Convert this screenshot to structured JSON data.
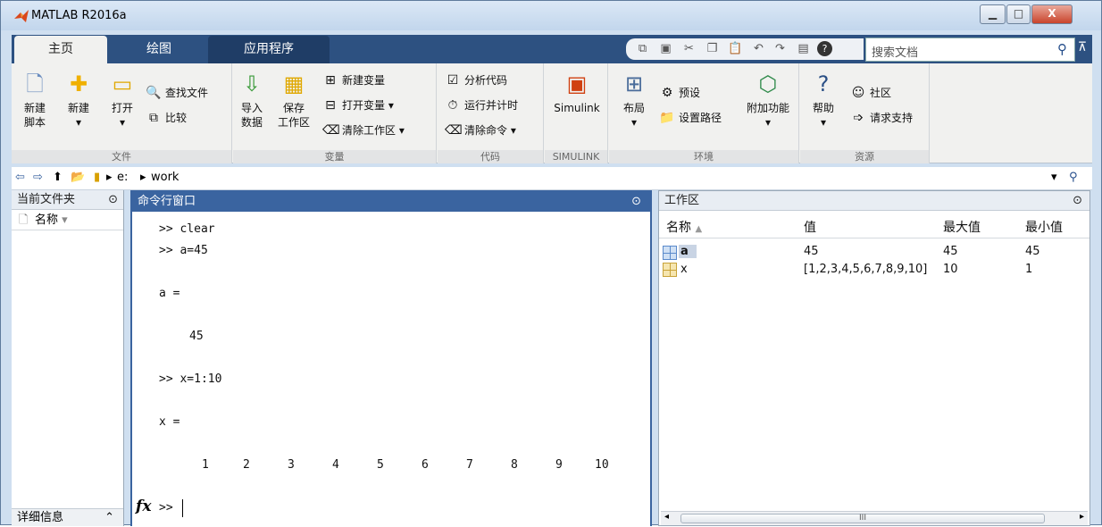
{
  "window": {
    "title": "MATLAB R2016a"
  },
  "tabs": [
    {
      "label": "主页"
    },
    {
      "label": "绘图"
    },
    {
      "label": "应用程序"
    }
  ],
  "search": {
    "placeholder": "搜索文档"
  },
  "ribbon": {
    "file": {
      "title": "文件",
      "new_script": "新建\n脚本",
      "new": "新建",
      "open": "打开",
      "find_files": "查找文件",
      "compare": "比较"
    },
    "variable": {
      "title": "变量",
      "import": "导入\n数据",
      "save": "保存\n工作区",
      "new_var": "新建变量",
      "open_var": "打开变量",
      "clear_ws": "清除工作区"
    },
    "code": {
      "title": "代码",
      "analyze": "分析代码",
      "run_time": "运行并计时",
      "clear_cmd": "清除命令"
    },
    "simulink": {
      "title": "SIMULINK",
      "label": "Simulink"
    },
    "env": {
      "title": "环境",
      "layout": "布局",
      "prefs": "预设",
      "set_path": "设置路径",
      "addons": "附加功能"
    },
    "resources": {
      "title": "资源",
      "help": "帮助",
      "community": "社区",
      "support": "请求支持"
    }
  },
  "address": {
    "drive": "e:",
    "folder": "work"
  },
  "current_folder": {
    "title": "当前文件夹",
    "name_col": "名称",
    "details": "详细信息"
  },
  "command_window": {
    "title": "命令行窗口",
    "prompt": ">>",
    "lines": [
      ">> clear",
      ">> a=45",
      "a =",
      "45",
      ">> x=1:10",
      "x ="
    ],
    "x_values": [
      "1",
      "2",
      "3",
      "4",
      "5",
      "6",
      "7",
      "8",
      "9",
      "10"
    ]
  },
  "workspace": {
    "title": "工作区",
    "columns": [
      "名称",
      "值",
      "最大值",
      "最小值"
    ],
    "rows": [
      {
        "name": "a",
        "value": "45",
        "max": "45",
        "min": "45"
      },
      {
        "name": "x",
        "value": "[1,2,3,4,5,6,7,8,9,10]",
        "max": "10",
        "min": "1"
      }
    ],
    "scroll": "III"
  }
}
